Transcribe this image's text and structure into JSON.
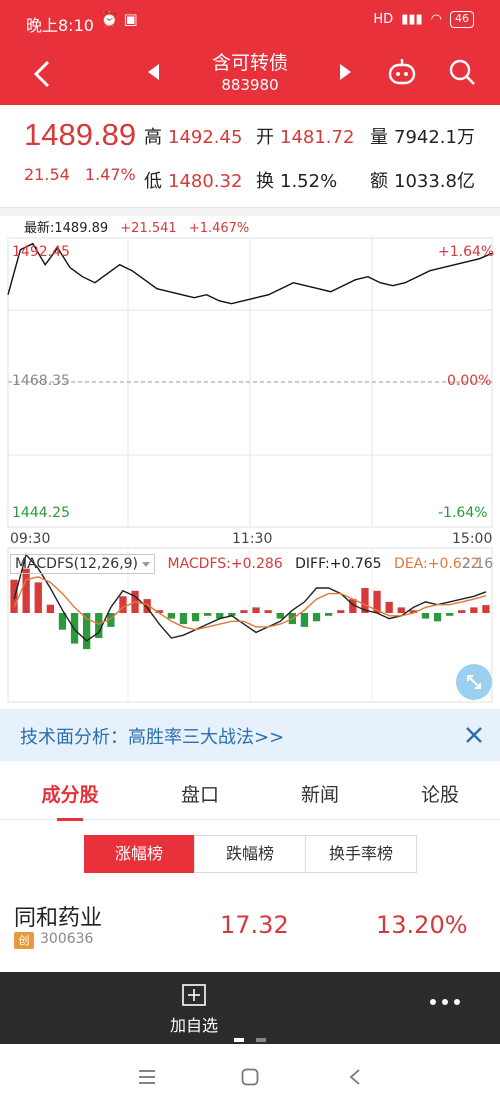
{
  "status_bar": {
    "time": "晚上8:10",
    "network": "HD",
    "battery": "46"
  },
  "header": {
    "title": "含可转债",
    "code": "883980"
  },
  "quote": {
    "price": "1489.89",
    "change": "21.54",
    "change_pct": "1.47%",
    "high_label": "高",
    "high": "1492.45",
    "open_label": "开",
    "open": "1481.72",
    "volume_label": "量",
    "volume": "7942.1万",
    "low_label": "低",
    "low": "1480.32",
    "turnover_label": "换",
    "turnover": "1.52%",
    "amount_label": "额",
    "amount": "1033.8亿"
  },
  "intraday": {
    "latest": "最新:1489.89",
    "change": "+21.541",
    "change_pct": "+1.467%",
    "y_top": "1492.45",
    "y_mid": "1468.35",
    "y_bottom": "1444.25",
    "pct_top": "+1.64%",
    "pct_mid": "0.00%",
    "pct_bottom": "-1.64%",
    "t_start": "09:30",
    "t_mid": "11:30",
    "t_end": "15:00"
  },
  "macd": {
    "selector": "MACDFS(12,26,9)",
    "macdfs": "MACDFS:+0.286",
    "diff": "DIFF:+0.765",
    "dea": "DEA:+0.622",
    "y_top": "2.16"
  },
  "chart_data": [
    {
      "type": "line",
      "title": "",
      "x_range": [
        "09:30",
        "15:00"
      ],
      "ylim": [
        1444.25,
        1492.45
      ],
      "reference": 1468.35,
      "series": [
        {
          "values": [
            1483.0,
            1490.5,
            1491.5,
            1488.0,
            1490.8,
            1487.5,
            1486.0,
            1485.0,
            1486.5,
            1488.0,
            1487.0,
            1485.5,
            1484.0,
            1483.5,
            1483.0,
            1482.5,
            1483.0,
            1482.0,
            1481.5,
            1482.0,
            1482.5,
            1483.0,
            1484.0,
            1485.0,
            1484.5,
            1484.0,
            1483.5,
            1484.5,
            1485.5,
            1486.0,
            1485.0,
            1484.5,
            1485.0,
            1486.0,
            1487.0,
            1487.5,
            1488.0,
            1488.5,
            1489.0,
            1489.89
          ]
        }
      ]
    },
    {
      "type": "bar",
      "title": "",
      "ylim": [
        -2.16,
        2.16
      ],
      "series": [
        {
          "name": "MACDFS",
          "values": [
            1.2,
            1.6,
            1.1,
            0.3,
            -0.6,
            -1.1,
            -1.3,
            -0.9,
            -0.5,
            0.6,
            0.8,
            0.5,
            0.1,
            -0.2,
            -0.4,
            -0.3,
            -0.1,
            -0.2,
            -0.1,
            0.1,
            0.2,
            0.1,
            -0.2,
            -0.4,
            -0.5,
            -0.3,
            -0.1,
            0.1,
            0.5,
            0.9,
            0.8,
            0.4,
            0.2,
            0.1,
            -0.2,
            -0.3,
            -0.1,
            0.1,
            0.2,
            0.286
          ]
        },
        {
          "name": "DIFF",
          "values": [
            0.5,
            2.1,
            1.6,
            0.9,
            0.1,
            -0.6,
            -1.0,
            -0.7,
            0.2,
            0.8,
            0.6,
            0.2,
            -0.4,
            -0.9,
            -0.8,
            -0.6,
            -0.4,
            -0.2,
            -0.1,
            -0.4,
            -0.7,
            -0.5,
            -0.3,
            0.1,
            0.4,
            0.9,
            0.9,
            0.7,
            0.3,
            0.1,
            0.0,
            -0.2,
            -0.1,
            0.2,
            0.4,
            0.3,
            0.4,
            0.5,
            0.6,
            0.765
          ]
        },
        {
          "name": "DEA",
          "values": [
            0.2,
            1.2,
            1.3,
            1.1,
            0.7,
            0.2,
            -0.2,
            -0.4,
            -0.2,
            0.2,
            0.4,
            0.3,
            0.0,
            -0.3,
            -0.5,
            -0.6,
            -0.5,
            -0.4,
            -0.3,
            -0.3,
            -0.5,
            -0.5,
            -0.4,
            -0.2,
            0.1,
            0.5,
            0.7,
            0.7,
            0.5,
            0.3,
            0.1,
            -0.1,
            -0.1,
            0.0,
            0.2,
            0.3,
            0.3,
            0.4,
            0.5,
            0.622
          ]
        }
      ]
    }
  ],
  "banner": {
    "text": "技术面分析：高胜率三大战法>>"
  },
  "tabs": [
    "成分股",
    "盘口",
    "新闻",
    "论股"
  ],
  "segments": [
    "涨幅榜",
    "跌幅榜",
    "换手率榜"
  ],
  "stock": {
    "name": "同和药业",
    "tag": "创",
    "code": "300636",
    "price": "17.32",
    "pct": "13.20%"
  },
  "bottom": {
    "add_label": "加自选"
  },
  "colors": {
    "red": "#e8313a",
    "up": "#d63a3a",
    "down": "#2a9a3c",
    "diff": "#222222",
    "dea": "#e0783a"
  },
  "icons": [
    "back-icon",
    "prev-triangle-icon",
    "next-triangle-icon",
    "robot-icon",
    "search-icon",
    "expand-icon",
    "close-icon",
    "add-icon",
    "more-icon",
    "menu-icon",
    "home-icon",
    "back-nav-icon"
  ]
}
